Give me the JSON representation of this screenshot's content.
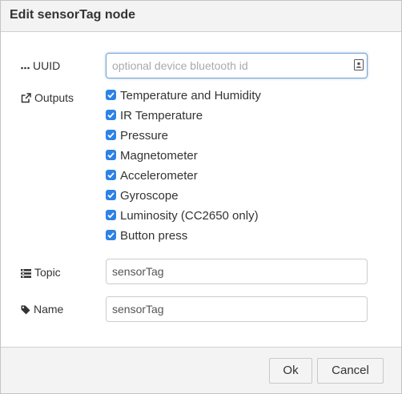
{
  "dialog": {
    "title": "Edit sensorTag node"
  },
  "uuid": {
    "label": "UUID",
    "value": "",
    "placeholder": "optional device bluetooth id"
  },
  "outputs": {
    "label": "Outputs",
    "items": [
      {
        "label": "Temperature and Humidity",
        "checked": true
      },
      {
        "label": "IR Temperature",
        "checked": true
      },
      {
        "label": "Pressure",
        "checked": true
      },
      {
        "label": "Magnetometer",
        "checked": true
      },
      {
        "label": "Accelerometer",
        "checked": true
      },
      {
        "label": "Gyroscope",
        "checked": true
      },
      {
        "label": "Luminosity (CC2650 only)",
        "checked": true
      },
      {
        "label": "Button press",
        "checked": true
      }
    ]
  },
  "topic": {
    "label": "Topic",
    "value": "sensorTag"
  },
  "name": {
    "label": "Name",
    "value": "sensorTag"
  },
  "buttons": {
    "ok": "Ok",
    "cancel": "Cancel"
  },
  "colors": {
    "checkbox": "#2d82e6",
    "focus_border": "#74a2d3",
    "header_bg": "#f3f3f3"
  },
  "icons": {
    "uuid": "ellipsis-icon",
    "outputs": "external-link-icon",
    "topic": "tasks-icon",
    "name": "tag-icon",
    "uuid_field": "address-book-icon"
  }
}
